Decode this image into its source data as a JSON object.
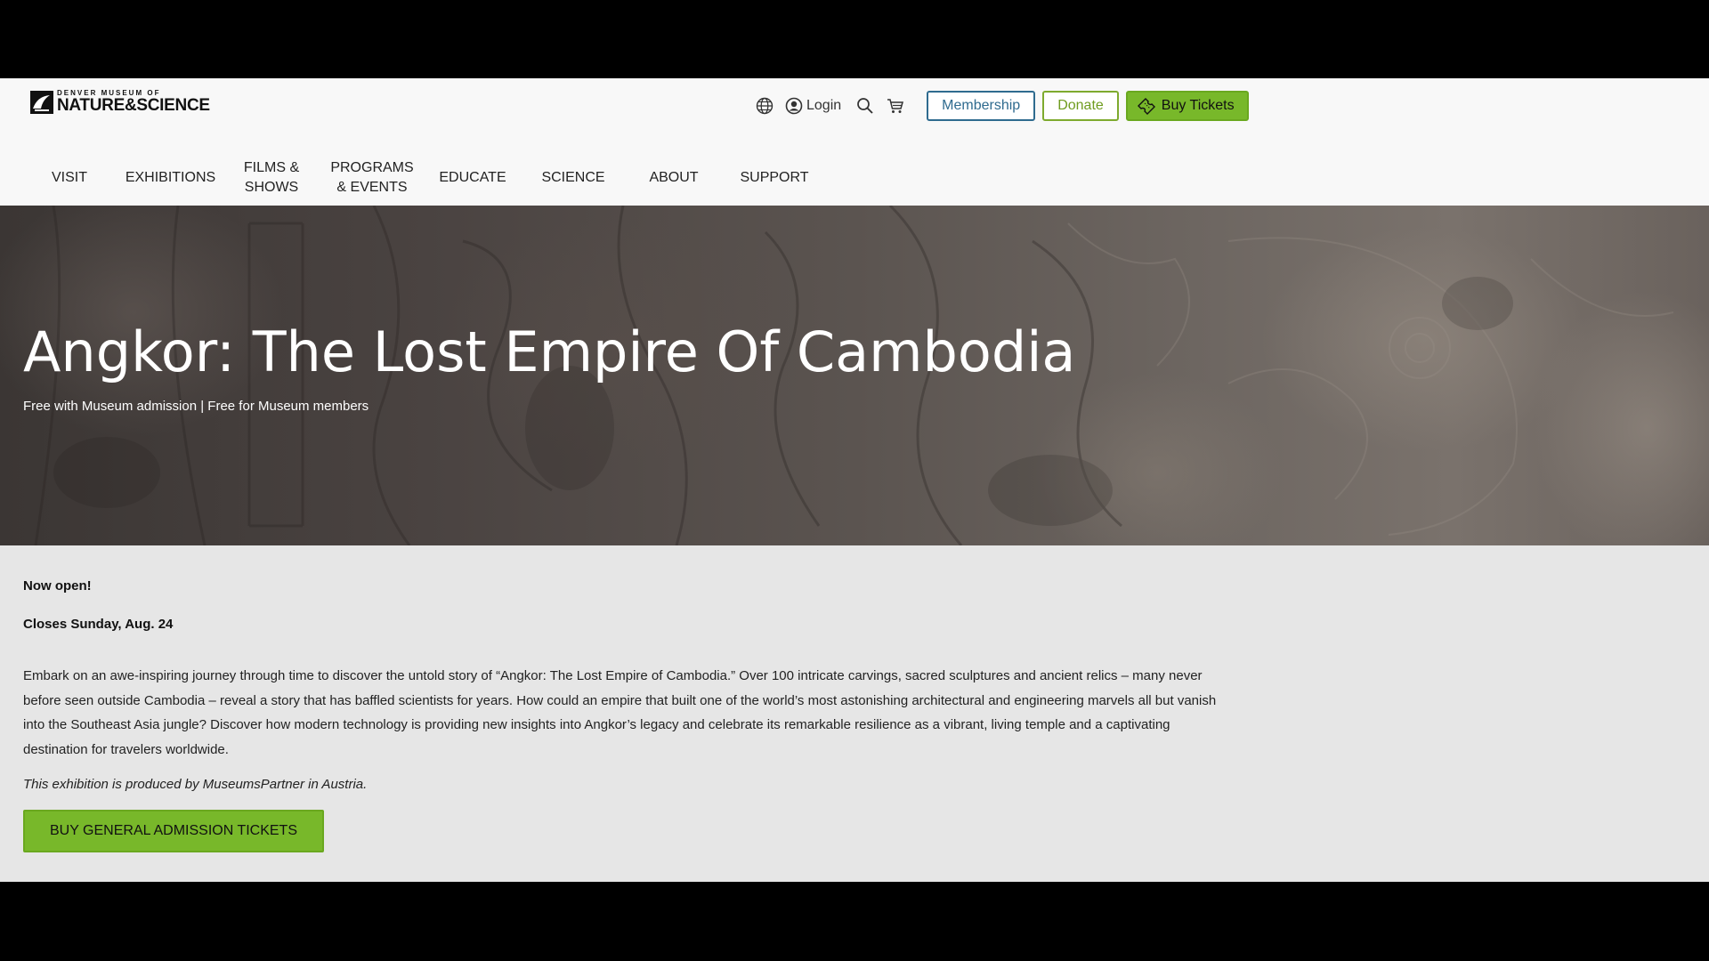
{
  "header": {
    "logo_top": "DENVER MUSEUM OF",
    "logo_bottom": "NATURE&SCIENCE",
    "login_label": "Login",
    "membership_label": "Membership",
    "donate_label": "Donate",
    "tickets_label": "Buy Tickets"
  },
  "nav": {
    "items": [
      {
        "label_line1": "VISIT",
        "label_line2": ""
      },
      {
        "label_line1": "EXHIBITIONS",
        "label_line2": ""
      },
      {
        "label_line1": "FILMS &",
        "label_line2": "SHOWS"
      },
      {
        "label_line1": "PROGRAMS",
        "label_line2": "& EVENTS"
      },
      {
        "label_line1": "EDUCATE",
        "label_line2": ""
      },
      {
        "label_line1": "SCIENCE",
        "label_line2": ""
      },
      {
        "label_line1": "ABOUT",
        "label_line2": ""
      },
      {
        "label_line1": "SUPPORT",
        "label_line2": ""
      }
    ]
  },
  "hero": {
    "title": "Angkor: The Lost Empire Of Cambodia",
    "subtitle": "Free with Museum admission | Free for Museum members"
  },
  "content": {
    "status_open": "Now open!",
    "status_closes": "Closes Sunday, Aug. 24",
    "description": "Embark on an awe-inspiring journey through time to discover the untold story of “Angkor: The Lost Empire of Cambodia.” Over 100 intricate carvings, sacred sculptures and ancient relics – many never before seen outside Cambodia – reveal a story that has baffled scientists for years. How could an empire that built one of the world’s most astonishing architectural and engineering marvels all but vanish into the Southeast Asia jungle? Discover how modern technology is providing new insights into Angkor’s legacy and celebrate its remarkable resilience as a vibrant, living temple and a captivating destination for travelers worldwide.",
    "credit": "This exhibition is produced by MuseumsPartner in Austria.",
    "cta_label": "BUY GENERAL ADMISSION TICKETS"
  },
  "icons": {
    "language": "globe-icon",
    "account": "user-circle-icon",
    "search": "search-icon",
    "cart": "cart-icon",
    "ticket": "ticket-icon"
  },
  "colors": {
    "accent_green": "#78b82a",
    "membership_blue": "#2f6b8f",
    "page_bg": "#e6e6e6",
    "header_bg": "#f8f8f8"
  }
}
